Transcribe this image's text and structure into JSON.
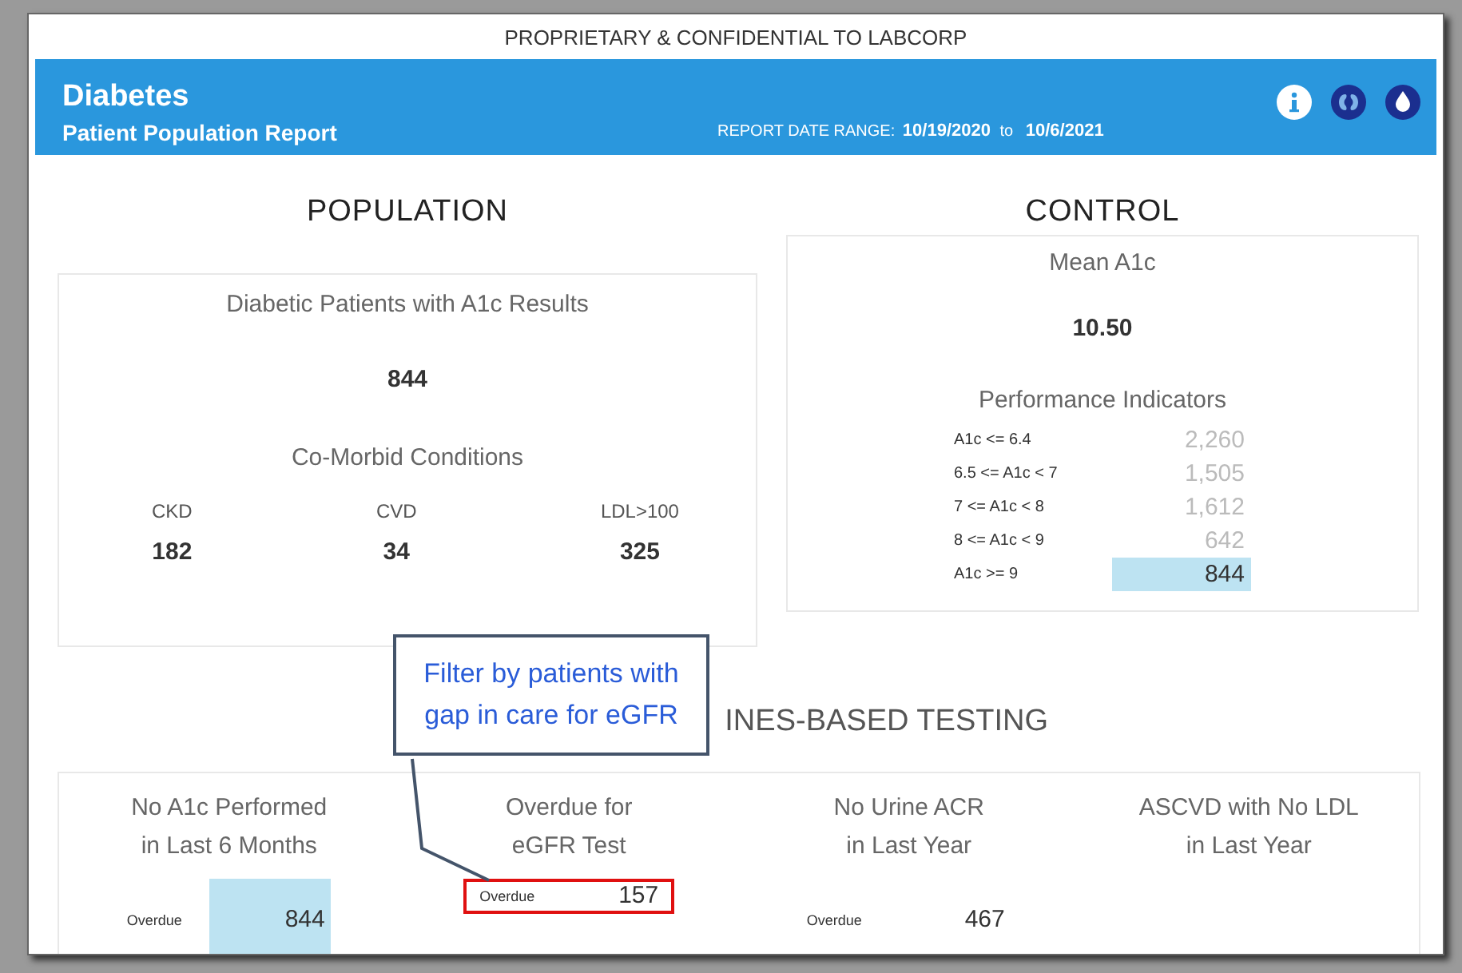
{
  "banner": "PROPRIETARY & CONFIDENTIAL TO LABCORP",
  "header": {
    "title": "Diabetes",
    "subtitle": "Patient Population Report",
    "date_range_label": "REPORT DATE RANGE:",
    "date_from": "10/19/2020",
    "date_sep": "to",
    "date_to": "10/6/2021"
  },
  "population": {
    "heading": "POPULATION",
    "title": "Diabetic Patients with A1c Results",
    "value": "844",
    "comorbid_title": "Co-Morbid Conditions",
    "conditions": [
      {
        "label": "CKD",
        "value": "182"
      },
      {
        "label": "CVD",
        "value": "34"
      },
      {
        "label": "LDL>100",
        "value": "325"
      }
    ]
  },
  "control": {
    "heading": "CONTROL",
    "mean_title": "Mean A1c",
    "mean_value": "10.50",
    "indicators_title": "Performance Indicators",
    "indicators": [
      {
        "label": "A1c <= 6.4",
        "value": "2,260",
        "selected": false
      },
      {
        "label": "6.5 <= A1c < 7",
        "value": "1,505",
        "selected": false
      },
      {
        "label": "7 <= A1c < 8",
        "value": "1,612",
        "selected": false
      },
      {
        "label": "8 <= A1c < 9",
        "value": "642",
        "selected": false
      },
      {
        "label": "A1c >= 9",
        "value": "844",
        "selected": true
      }
    ]
  },
  "testing": {
    "heading": "INES-BASED TESTING",
    "metrics": [
      {
        "title": "No A1c Performed\nin Last 6 Months",
        "label": "Overdue",
        "value": "844",
        "selected": true,
        "outlined": false
      },
      {
        "title": "Overdue for\neGFR Test",
        "label": "Overdue",
        "value": "157",
        "selected": false,
        "outlined": true
      },
      {
        "title": "No Urine ACR\nin Last Year",
        "label": "Overdue",
        "value": "467",
        "selected": false,
        "outlined": false
      },
      {
        "title": "ASCVD with No LDL\nin Last Year"
      }
    ]
  },
  "callout": {
    "text": "Filter by patients with gap in care for eGFR"
  }
}
